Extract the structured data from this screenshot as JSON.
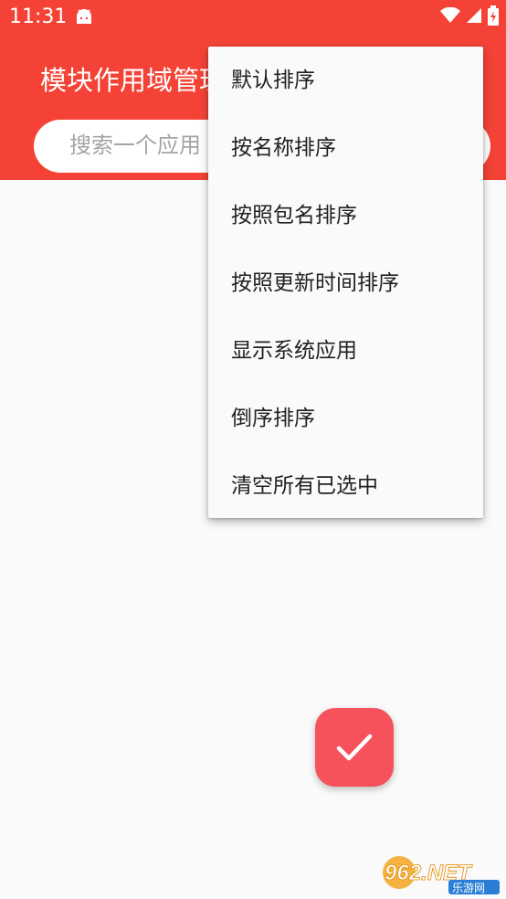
{
  "status_bar": {
    "time": "11:31"
  },
  "app_bar": {
    "title": "模块作用域管理",
    "search_placeholder": "搜索一个应用"
  },
  "popup_menu": {
    "items": [
      {
        "label": "默认排序"
      },
      {
        "label": "按名称排序"
      },
      {
        "label": "按照包名排序"
      },
      {
        "label": "按照更新时间排序"
      },
      {
        "label": "显示系统应用"
      },
      {
        "label": "倒序排序"
      },
      {
        "label": "清空所有已选中"
      }
    ]
  },
  "colors": {
    "primary": "#f44336",
    "fab": "#f6525c"
  },
  "watermark": {
    "brand": "962.NET",
    "subtitle": "乐游网"
  }
}
